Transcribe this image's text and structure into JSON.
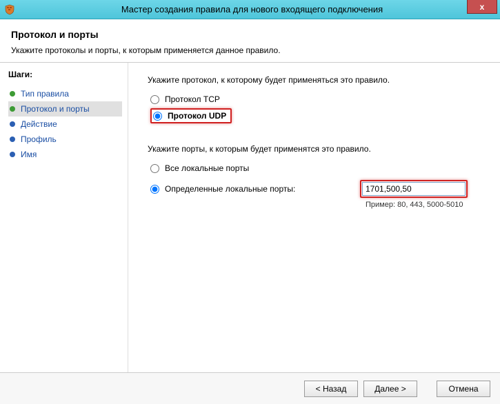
{
  "window": {
    "title": "Мастер создания правила для нового входящего подключения",
    "close_label": "x"
  },
  "header": {
    "title": "Протокол и порты",
    "subtitle": "Укажите протоколы и порты, к которым применяется данное правило."
  },
  "sidebar": {
    "steps_label": "Шаги:",
    "items": [
      {
        "label": "Тип правила",
        "state": "done"
      },
      {
        "label": "Протокол и порты",
        "state": "current"
      },
      {
        "label": "Действие",
        "state": "todo"
      },
      {
        "label": "Профиль",
        "state": "todo"
      },
      {
        "label": "Имя",
        "state": "todo"
      }
    ]
  },
  "main": {
    "protocol_instruction": "Укажите протокол, к которому будет применяться это правило.",
    "protocol_tcp_label": "Протокол TCP",
    "protocol_udp_label": "Протокол UDP",
    "protocol_selected": "udp",
    "ports_instruction": "Укажите порты, к которым будет применятся это правило.",
    "all_ports_label": "Все локальные порты",
    "specific_ports_label": "Определенные локальные порты:",
    "ports_selected": "specific",
    "port_value": "1701,500,50",
    "port_example": "Пример: 80, 443, 5000-5010"
  },
  "footer": {
    "back_label": "< Назад",
    "next_label": "Далее >",
    "cancel_label": "Отмена"
  }
}
